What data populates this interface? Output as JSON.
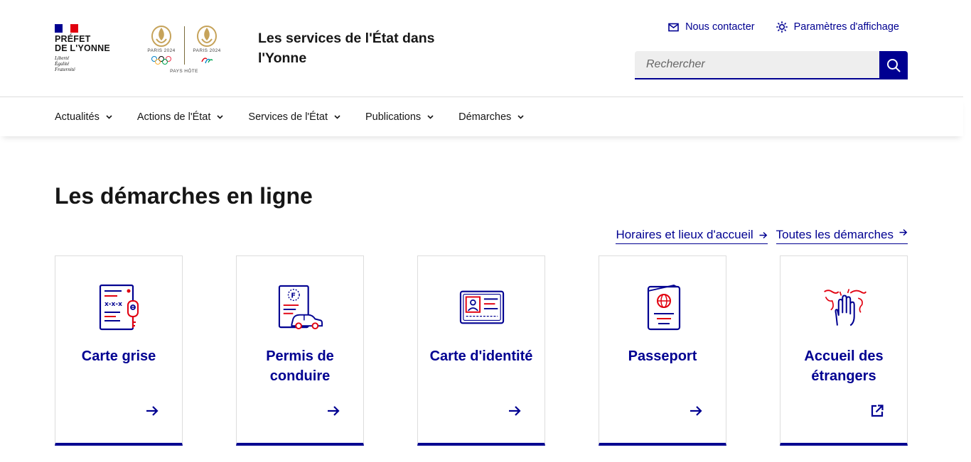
{
  "header": {
    "prefet_name": "PRÉFET\nDE L'YONNE",
    "devise": "Liberté\nÉgalité\nFraternité",
    "paris_left": "PARIS 2024",
    "paris_right": "PARIS 2024",
    "pays_hote": "PAYS HÔTE",
    "site_title": "Les services de l'État dans l'Yonne",
    "tools": {
      "contact_label": "Nous contacter",
      "display_label": "Paramètres d'affichage"
    },
    "search": {
      "placeholder": "Rechercher"
    }
  },
  "nav": {
    "items": [
      {
        "label": "Actualités"
      },
      {
        "label": "Actions de l'État"
      },
      {
        "label": "Services de l'État"
      },
      {
        "label": "Publications"
      },
      {
        "label": "Démarches"
      }
    ]
  },
  "main": {
    "title": "Les démarches en ligne",
    "links": [
      {
        "label": "Horaires et lieux d'accueil"
      },
      {
        "label": "Toutes les démarches"
      }
    ],
    "cards": [
      {
        "title": "Carte grise",
        "icon": "car-registration-icon",
        "arrow": "arrow-right-icon"
      },
      {
        "title": "Permis de conduire",
        "icon": "driving-licence-icon",
        "arrow": "arrow-right-icon"
      },
      {
        "title": "Carte d'identité",
        "icon": "id-card-icon",
        "arrow": "arrow-right-icon"
      },
      {
        "title": "Passeport",
        "icon": "passport-icon",
        "arrow": "arrow-right-icon"
      },
      {
        "title": "Accueil des étrangers",
        "icon": "welcome-hand-icon",
        "arrow": "external-link-icon"
      }
    ]
  },
  "colors": {
    "primary_blue": "#000091",
    "accent_red": "#e1000f",
    "olympic_gold": "#c6a35a"
  }
}
